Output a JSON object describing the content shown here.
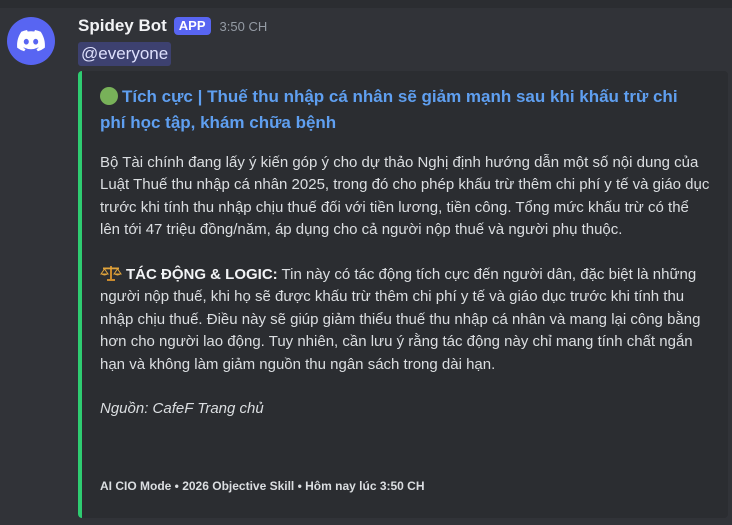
{
  "message": {
    "author": "Spidey Bot",
    "badge": "APP",
    "time": "3:50 CH",
    "mention": "@everyone",
    "avatar_icon": "discord-logo-icon",
    "avatar_color": "#5865f2"
  },
  "embed": {
    "accent_color": "#2ecc71",
    "title_emoji": "green-circle-icon",
    "title": "Tích cực | Thuế thu nhập cá nhân sẽ giảm mạnh sau khi khấu trừ chi phí học tập, khám chữa bệnh",
    "paragraph1": "Bộ Tài chính đang lấy ý kiến góp ý cho dự thảo Nghị định hướng dẫn một số nội dung của Luật Thuế thu nhập cá nhân 2025, trong đó cho phép khấu trừ thêm chi phí y tế và giáo dục trước khi tính thu nhập chịu thuế đối với tiền lương, tiền công. Tổng mức khấu trừ có thể lên tới 47 triệu đồng/năm, áp dụng cho cả người nộp thuế và người phụ thuộc.",
    "impact_emoji": "balance-scale-icon",
    "impact_label": "TÁC ĐỘNG & LOGIC:",
    "impact_text": " Tin này có tác động tích cực đến người dân, đặc biệt là những người nộp thuế, khi họ sẽ được khấu trừ thêm chi phí y tế và giáo dục trước khi tính thu nhập chịu thuế. Điều này sẽ giúp giảm thiểu thuế thu nhập cá nhân và mang lại công bằng hơn cho người lao động. Tuy nhiên, cần lưu ý rằng tác động này chỉ mang tính chất ngắn hạn và không làm giảm nguồn thu ngân sách trong dài hạn.",
    "source": "Nguồn: CafeF Trang chủ",
    "footer": "AI CIO Mode • 2026 Objective Skill • Hôm nay lúc 3:50 CH"
  }
}
